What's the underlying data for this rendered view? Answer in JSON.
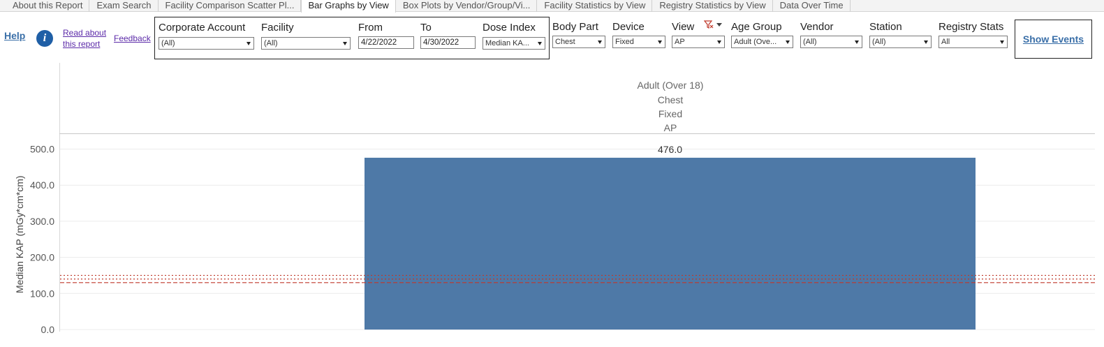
{
  "tabs": [
    {
      "label": "About this Report",
      "active": false
    },
    {
      "label": "Exam Search",
      "active": false
    },
    {
      "label": "Facility Comparison Scatter Pl...",
      "active": false
    },
    {
      "label": "Bar Graphs by View",
      "active": true
    },
    {
      "label": "Box Plots by Vendor/Group/Vi...",
      "active": false
    },
    {
      "label": "Facility Statistics by View",
      "active": false
    },
    {
      "label": "Registry Statistics by View",
      "active": false
    },
    {
      "label": "Data Over Time",
      "active": false
    }
  ],
  "links": {
    "help": "Help",
    "info": "i",
    "read_about": "Read about this report",
    "feedback": "Feedback"
  },
  "filters": {
    "corporate_account": {
      "label": "Corporate Account",
      "value": "(All)"
    },
    "facility": {
      "label": "Facility",
      "value": "(All)"
    },
    "from": {
      "label": "From",
      "value": "4/22/2022"
    },
    "to": {
      "label": "To",
      "value": "4/30/2022"
    },
    "dose_index": {
      "label": "Dose Index",
      "value": "Median KA..."
    },
    "body_part": {
      "label": "Body Part",
      "value": "Chest"
    },
    "device": {
      "label": "Device",
      "value": "Fixed"
    },
    "view": {
      "label": "View",
      "value": "AP"
    },
    "age_group": {
      "label": "Age Group",
      "value": "Adult (Ove..."
    },
    "vendor": {
      "label": "Vendor",
      "value": "(All)"
    },
    "station": {
      "label": "Station",
      "value": "(All)"
    },
    "registry_stats": {
      "label": "Registry Stats",
      "value": "All"
    }
  },
  "show_events": "Show Events",
  "chart_data": {
    "type": "bar",
    "header": [
      "Adult (Over 18)",
      "Chest",
      "Fixed",
      "AP"
    ],
    "categories": [
      "Adult (Over 18) / Chest / Fixed / AP"
    ],
    "values": [
      476.0
    ],
    "value_labels": [
      "476.0"
    ],
    "ylabel": "Median KAP (mGy*cm*cm)",
    "ylim": [
      0,
      530
    ],
    "yticks": [
      0,
      100,
      200,
      300,
      400,
      500
    ],
    "ytick_labels": [
      "0.0",
      "100.0",
      "200.0",
      "300.0",
      "400.0",
      "500.0"
    ],
    "reference_lines": [
      {
        "value": 150,
        "style": "dotted",
        "color": "#c0392b"
      },
      {
        "value": 140,
        "style": "dotted",
        "color": "#c0392b"
      },
      {
        "value": 130,
        "style": "dashed",
        "color": "#c0392b"
      }
    ],
    "bar_color": "#4e79a7",
    "grid": true
  }
}
